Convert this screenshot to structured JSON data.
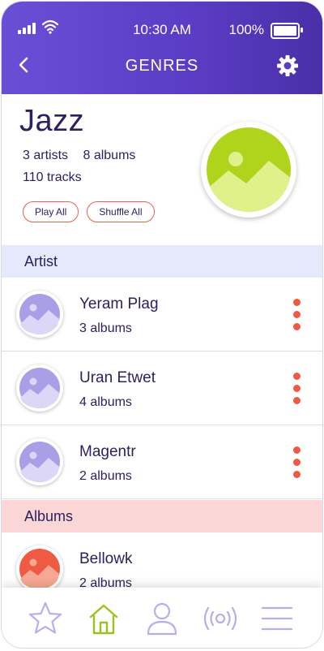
{
  "status": {
    "time": "10:30 AM",
    "battery": "100%"
  },
  "header": {
    "title": "GENRES"
  },
  "genre": {
    "name": "Jazz",
    "artists": "3 artists",
    "albums": "8 albums",
    "tracks": "110 tracks",
    "play_all": "Play All",
    "shuffle_all": "Shuffle All",
    "cover_color": "#b0d31b"
  },
  "sections": {
    "artist": "Artist",
    "albums": "Albums"
  },
  "artists": [
    {
      "name": "Yeram Plag",
      "sub": "3 albums"
    },
    {
      "name": "Uran Etwet",
      "sub": "4 albums"
    },
    {
      "name": "Magentr",
      "sub": "2 albums"
    }
  ],
  "albums": [
    {
      "name": "Bellowk",
      "sub": "2 albums"
    }
  ],
  "colors": {
    "accent": "#5b3cc4",
    "more_dots": "#ee5b42",
    "artist_thumb": "#a99fe6",
    "album_thumb": "#ee5b42",
    "tab_icon": "#b8aee8",
    "tab_active": "#9bc31f"
  },
  "tabs": [
    {
      "icon": "star-icon"
    },
    {
      "icon": "home-icon",
      "active": true
    },
    {
      "icon": "user-icon"
    },
    {
      "icon": "broadcast-icon"
    },
    {
      "icon": "menu-icon"
    }
  ]
}
